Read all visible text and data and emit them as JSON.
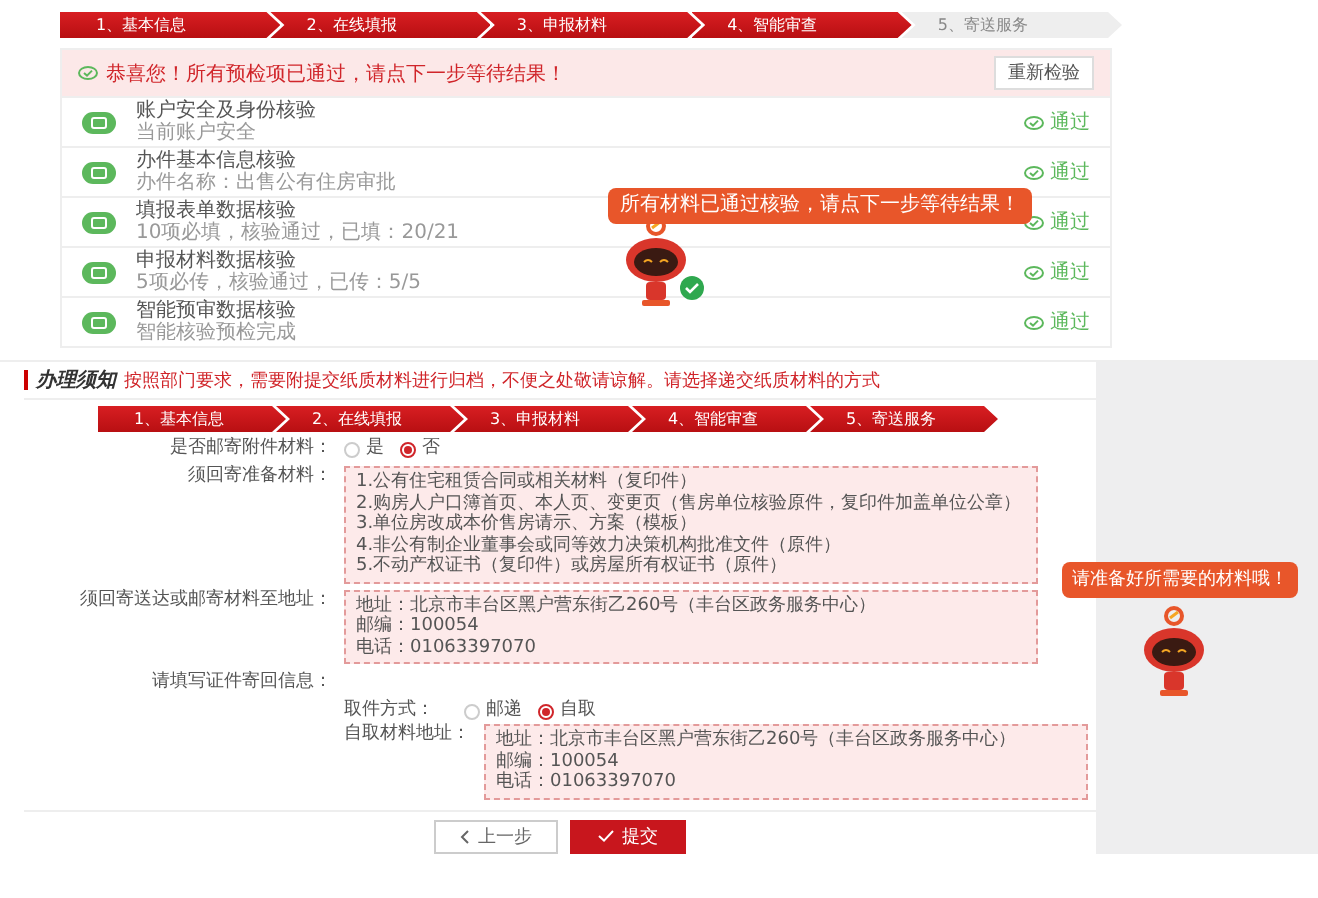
{
  "precheck": {
    "steps": [
      {
        "label": "1、基本信息",
        "done": true
      },
      {
        "label": "2、在线填报",
        "done": true
      },
      {
        "label": "3、申报材料",
        "done": true
      },
      {
        "label": "4、智能审查",
        "done": true
      },
      {
        "label": "5、寄送服务",
        "done": false
      }
    ],
    "message": "恭喜您！所有预检项已通过，请点下一步等待结果！",
    "recheck_button": "重新检验",
    "checks": [
      {
        "title": "账户安全及身份核验",
        "detail": "当前账户安全",
        "status": "通过"
      },
      {
        "title": "办件基本信息核验",
        "detail": "办件名称：出售公有住房审批",
        "status": "通过"
      },
      {
        "title": "填报表单数据核验",
        "detail": "10项必填，核验通过，已填：20/21",
        "status": "通过"
      },
      {
        "title": "申报材料数据核验",
        "detail": "5项必传，核验通过，已传：5/5",
        "status": "通过"
      },
      {
        "title": "智能预审数据核验",
        "detail": "智能核验预检完成",
        "status": "通过"
      }
    ],
    "robot_tip": "所有材料已通过核验，请点下一步等待结果！"
  },
  "delivery": {
    "notice_label": "办理须知",
    "notice": "按照部门要求，需要附提交纸质材料进行归档，不便之处敬请谅解。请选择递交纸质材料的方式",
    "steps": [
      {
        "label": "1、基本信息",
        "done": true
      },
      {
        "label": "2、在线填报",
        "done": true
      },
      {
        "label": "3、申报材料",
        "done": true
      },
      {
        "label": "4、智能审查",
        "done": true
      },
      {
        "label": "5、寄送服务",
        "done": true
      }
    ],
    "mail_question": "是否邮寄附件材料：",
    "mail_options": [
      {
        "label": "是",
        "selected": false
      },
      {
        "label": "否",
        "selected": true
      }
    ],
    "materials_label": "须回寄准备材料：",
    "materials": [
      "1.公有住宅租赁合同或相关材料（复印件）",
      "2.购房人户口簿首页、本人页、变更页（售房单位核验原件，复印件加盖单位公章）",
      "3.单位房改成本价售房请示、方案（模板）",
      "4.非公有制企业董事会或同等效力决策机构批准文件（原件）",
      "5.不动产权证书（复印件）或房屋所有权证书（原件）"
    ],
    "send_label": "须回寄送达或邮寄材料至地址：",
    "send_address": [
      "地址：北京市丰台区黑户营东街乙260号（丰台区政务服务中心）",
      "邮编：100054",
      "电话：01063397070"
    ],
    "return_label": "请填写证件寄回信息：",
    "method_label": "取件方式：",
    "method_options": [
      {
        "label": "邮递",
        "selected": false
      },
      {
        "label": "自取",
        "selected": true
      }
    ],
    "pickup_label": "自取材料地址：",
    "pickup_address": [
      "地址：北京市丰台区黑户营东街乙260号（丰台区政务服务中心）",
      "邮编：100054",
      "电话：01063397070"
    ],
    "robot_tip": "请准备好所需要的材料哦！",
    "back_button": "上一步",
    "submit_button": "提交"
  }
}
